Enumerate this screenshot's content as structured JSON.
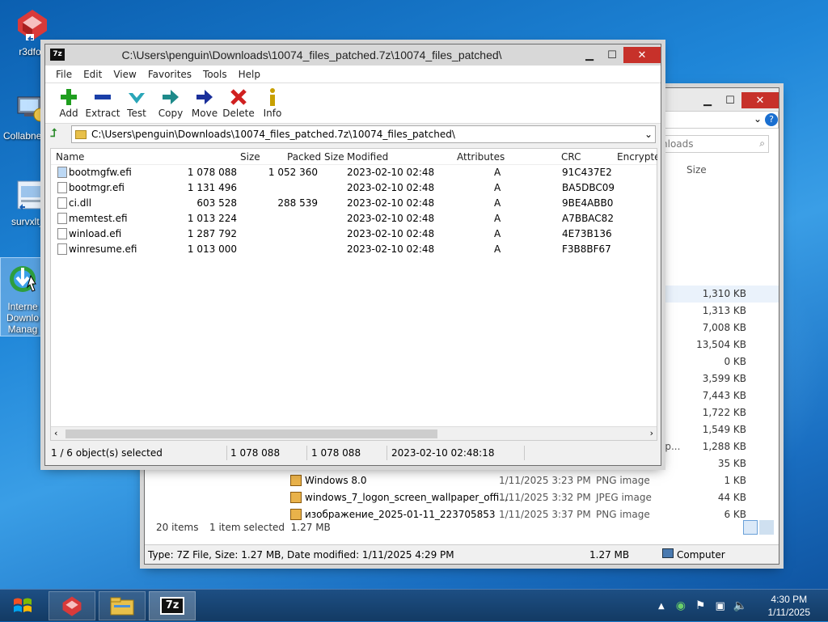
{
  "desktop": {
    "icons": [
      {
        "label": "r3dfox"
      },
      {
        "label": "Collabne"
      },
      {
        "label": "survxlt_h"
      },
      {
        "label_lines": [
          "Interne",
          "Downlo",
          "Manag"
        ]
      }
    ]
  },
  "explorer": {
    "search_placeholder": "nloads",
    "col_size": "Size",
    "rows": [
      {
        "size": "1,310 KB"
      },
      {
        "size": "1,313 KB"
      },
      {
        "size": "7,008 KB"
      },
      {
        "size": "13,504 KB"
      },
      {
        "size": "0 KB"
      },
      {
        "size": "3,599 KB"
      },
      {
        "size": "7,443 KB"
      },
      {
        "size": "1,722 KB"
      },
      {
        "size": "1,549 KB"
      },
      {
        "size": "1,288 KB",
        "type": "op..."
      },
      {
        "size": "35 KB"
      },
      {
        "name": "Windows 8.0",
        "date": "1/11/2025 3:23 PM",
        "type": "PNG image",
        "size": "1 KB"
      },
      {
        "name": "windows_7_logon_screen_wallpaper_offi...",
        "date": "1/11/2025 3:32 PM",
        "type": "JPEG image",
        "size": "44 KB"
      },
      {
        "name": "изображение_2025-01-11_223705853",
        "date": "1/11/2025 3:37 PM",
        "type": "PNG image",
        "size": "6 KB"
      }
    ],
    "status_items": "20 items",
    "status_selected": "1 item selected  1.27 MB",
    "details": "Type: 7Z File, Size: 1.27 MB, Date modified: 1/11/2025 4:29 PM",
    "details_size": "1.27 MB",
    "details_location": "Computer"
  },
  "sevenzip": {
    "title": "C:\\Users\\penguin\\Downloads\\10074_files_patched.7z\\10074_files_patched\\",
    "menu": [
      "File",
      "Edit",
      "View",
      "Favorites",
      "Tools",
      "Help"
    ],
    "tools": [
      {
        "label": "Add",
        "icon": "plus-icon",
        "color": "#1f9e1f"
      },
      {
        "label": "Extract",
        "icon": "minus-icon",
        "color": "#1a3fa8"
      },
      {
        "label": "Test",
        "icon": "check-icon",
        "color": "#2aa6b8"
      },
      {
        "label": "Copy",
        "icon": "arrow-right-icon",
        "color": "#1e8a8a"
      },
      {
        "label": "Move",
        "icon": "arrow-right-icon",
        "color": "#1a2f9a"
      },
      {
        "label": "Delete",
        "icon": "x-icon",
        "color": "#d02020"
      },
      {
        "label": "Info",
        "icon": "info-icon",
        "color": "#c8a000"
      }
    ],
    "path": "C:\\Users\\penguin\\Downloads\\10074_files_patched.7z\\10074_files_patched\\",
    "columns": {
      "name": "Name",
      "size": "Size",
      "packed": "Packed Size",
      "modified": "Modified",
      "attributes": "Attributes",
      "crc": "CRC",
      "encrypted": "Encrypte"
    },
    "files": [
      {
        "name": "bootmgfw.efi",
        "size": "1 078 088",
        "packed": "1 052 360",
        "modified": "2023-02-10 02:48",
        "attr": "A",
        "crc": "91C437E2",
        "selected": true
      },
      {
        "name": "bootmgr.efi",
        "size": "1 131 496",
        "packed": "",
        "modified": "2023-02-10 02:48",
        "attr": "A",
        "crc": "BA5DBC09"
      },
      {
        "name": "ci.dll",
        "size": "603 528",
        "packed": "288 539",
        "modified": "2023-02-10 02:48",
        "attr": "A",
        "crc": "9BE4ABB0"
      },
      {
        "name": "memtest.efi",
        "size": "1 013 224",
        "packed": "",
        "modified": "2023-02-10 02:48",
        "attr": "A",
        "crc": "A7BBAC82"
      },
      {
        "name": "winload.efi",
        "size": "1 287 792",
        "packed": "",
        "modified": "2023-02-10 02:48",
        "attr": "A",
        "crc": "4E73B136"
      },
      {
        "name": "winresume.efi",
        "size": "1 013 000",
        "packed": "",
        "modified": "2023-02-10 02:48",
        "attr": "A",
        "crc": "F3B8BF67"
      }
    ],
    "status": {
      "selected": "1 / 6 object(s) selected",
      "size": "1 078 088",
      "packed": "1 078 088",
      "modified": "2023-02-10 02:48:18"
    }
  },
  "taskbar": {
    "time": "4:30 PM",
    "date": "1/11/2025",
    "apps": [
      "r3dfox",
      "File Explorer",
      "7-Zip"
    ]
  }
}
